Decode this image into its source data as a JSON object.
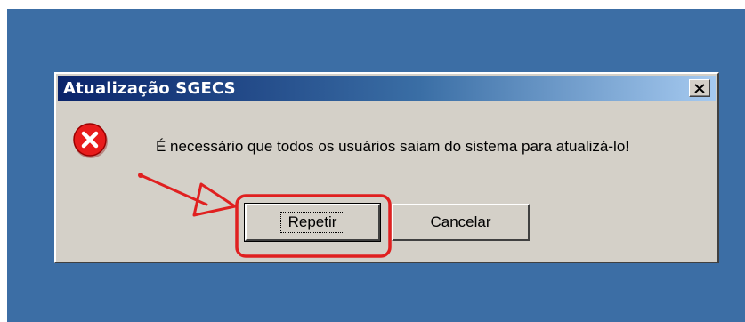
{
  "dialog": {
    "title": "Atualização SGECS",
    "close_icon": "close-icon",
    "error_icon": "error-icon",
    "message": "É necessário que todos os usuários saiam do sistema para atualizá-lo!",
    "buttons": {
      "retry_label": "Repetir",
      "cancel_label": "Cancelar"
    }
  },
  "colors": {
    "desktop": "#3c6ea5",
    "titlebar_start": "#0a246a",
    "titlebar_end": "#a6caf0",
    "dialog_face": "#d4d0c8",
    "annotation": "#e02020"
  }
}
